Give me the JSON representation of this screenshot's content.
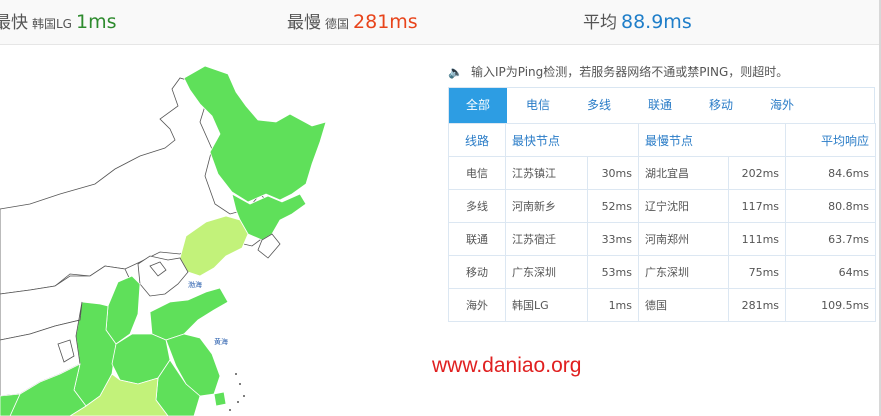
{
  "stats": {
    "fastest": {
      "label": "最快",
      "node": "韩国LG",
      "value": "1ms"
    },
    "slowest": {
      "label": "最慢",
      "node": "德国",
      "value": "281ms"
    },
    "average": {
      "label": "平均",
      "value": "88.9ms"
    }
  },
  "map": {
    "labels": [
      "渤海",
      "黄海"
    ],
    "colors": {
      "fast": "#5fe05a",
      "medium": "#c2f27a",
      "border": "#ffffff",
      "outline": "#555555"
    }
  },
  "notice": "输入IP为Ping检测，若服务器网络不通或禁PING，则超时。",
  "tabs": [
    "全部",
    "电信",
    "多线",
    "联通",
    "移动",
    "海外"
  ],
  "table": {
    "headers": [
      "线路",
      "最快节点",
      "最慢节点",
      "平均响应"
    ],
    "rows": [
      {
        "isp": "电信",
        "fast_node": "江苏镇江",
        "fast_ms": "30ms",
        "slow_node": "湖北宜昌",
        "slow_ms": "202ms",
        "avg": "84.6ms"
      },
      {
        "isp": "多线",
        "fast_node": "河南新乡",
        "fast_ms": "52ms",
        "slow_node": "辽宁沈阳",
        "slow_ms": "117ms",
        "avg": "80.8ms"
      },
      {
        "isp": "联通",
        "fast_node": "江苏宿迁",
        "fast_ms": "33ms",
        "slow_node": "河南郑州",
        "slow_ms": "111ms",
        "avg": "63.7ms"
      },
      {
        "isp": "移动",
        "fast_node": "广东深圳",
        "fast_ms": "53ms",
        "slow_node": "广东深圳",
        "slow_ms": "75ms",
        "avg": "64ms"
      },
      {
        "isp": "海外",
        "fast_node": "韩国LG",
        "fast_ms": "1ms",
        "slow_node": "德国",
        "slow_ms": "281ms",
        "avg": "109.5ms"
      }
    ]
  },
  "watermark": "www.daniao.org"
}
